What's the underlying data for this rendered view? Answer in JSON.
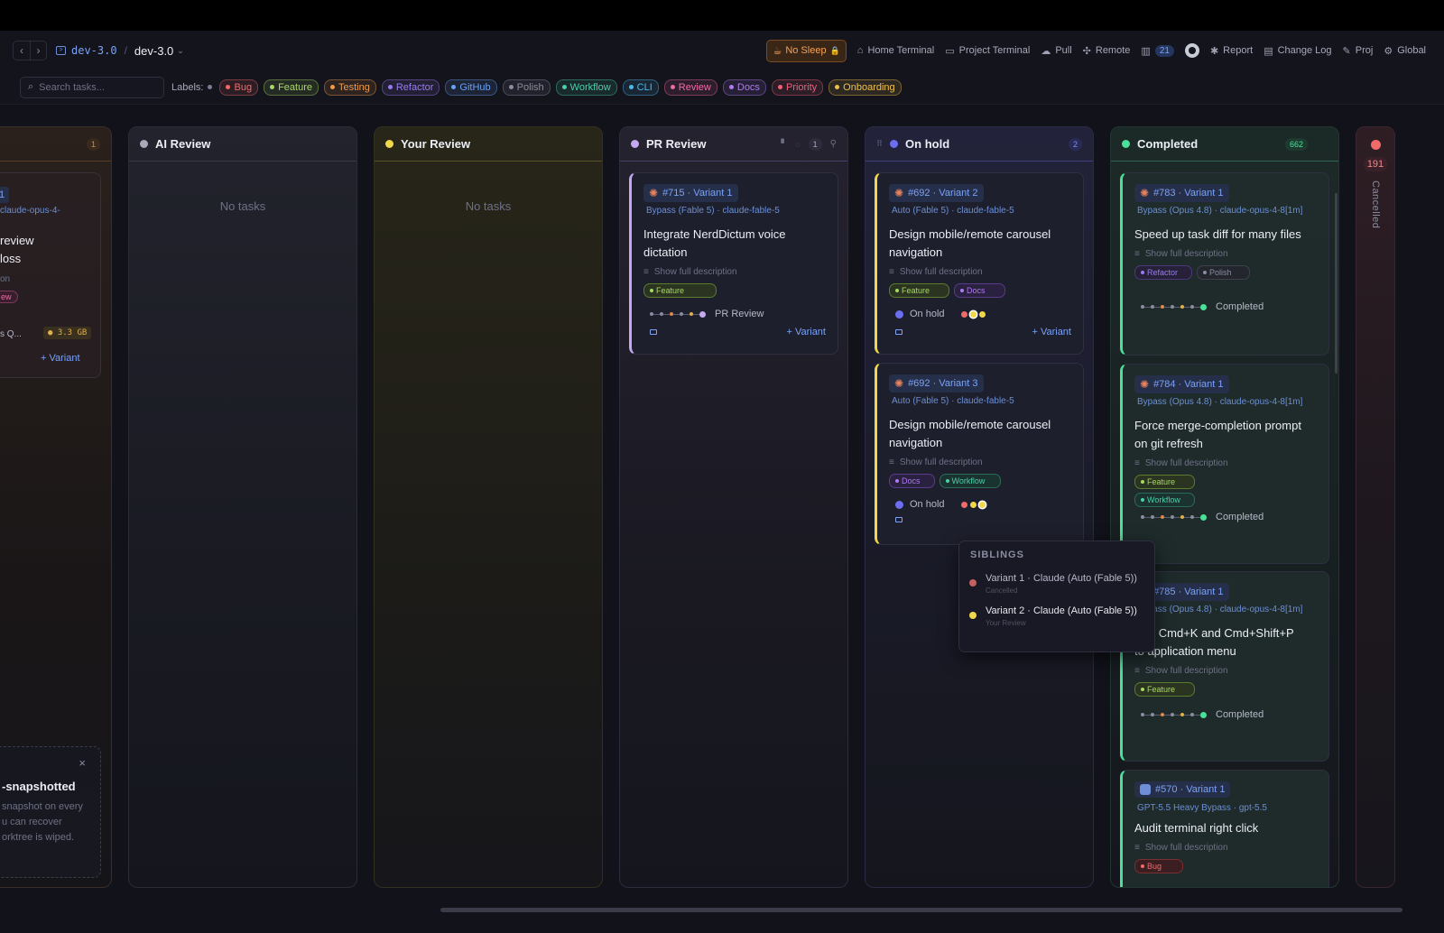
{
  "header": {
    "repo": "dev-3.0",
    "branch": "dev-3.0",
    "no_sleep": "No Sleep",
    "home_terminal": "Home Terminal",
    "project_terminal": "Project Terminal",
    "pull": "Pull",
    "remote": "Remote",
    "count": "21",
    "report": "Report",
    "changelog": "Change Log",
    "proj": "Proj",
    "global": "Global"
  },
  "filters": {
    "search_placeholder": "Search tasks...",
    "labels_title": "Labels:",
    "chips": [
      {
        "label": "Bug",
        "color": "#f06a6a"
      },
      {
        "label": "Feature",
        "color": "#a8d860"
      },
      {
        "label": "Testing",
        "color": "#f09a4a"
      },
      {
        "label": "Refactor",
        "color": "#9a7af0"
      },
      {
        "label": "GitHub",
        "color": "#6aa0f0"
      },
      {
        "label": "Polish",
        "color": "#8a8da0"
      },
      {
        "label": "Workflow",
        "color": "#4ad0a8"
      },
      {
        "label": "CLI",
        "color": "#4ab8f0"
      },
      {
        "label": "Review",
        "color": "#f06aa8"
      },
      {
        "label": "Docs",
        "color": "#b07af0"
      },
      {
        "label": "Priority",
        "color": "#f0607a"
      },
      {
        "label": "Onboarding",
        "color": "#f0c04a"
      }
    ]
  },
  "columns": {
    "left": {
      "count": "1",
      "tag": "1",
      "model": "claude-opus-4-",
      "title_a": "review",
      "title_b": "loss",
      "desc": "on",
      "label": "ew",
      "mem_text": "s Q...",
      "mem": "3.3 GB",
      "add": "+ Variant",
      "toast_title": "-snapshotted",
      "toast_l1": "snapshot on every",
      "toast_l2": "u can recover",
      "toast_l3": "orktree is wiped.",
      "toast_close": "×"
    },
    "ai_review": {
      "title": "AI Review",
      "empty": "No tasks"
    },
    "your_review": {
      "title": "Your Review",
      "empty": "No tasks"
    },
    "pr_review": {
      "title": "PR Review",
      "count": "1"
    },
    "on_hold": {
      "title": "On hold",
      "count": "2"
    },
    "completed": {
      "title": "Completed",
      "count": "662"
    },
    "cancelled": {
      "title": "Cancelled",
      "count": "191"
    }
  },
  "cards": {
    "pr1": {
      "tag": "#715 · Variant 1",
      "model": "Bypass (Fable 5) · claude-fable-5",
      "title": "Integrate NerdDictum voice dictation",
      "desc": "Show full description",
      "labels": [
        "Feature"
      ],
      "status": "PR Review",
      "add": "+ Variant"
    },
    "oh1": {
      "tag": "#692 · Variant 2",
      "model": "Auto (Fable 5) · claude-fable-5",
      "title": "Design mobile/remote carousel navigation",
      "desc": "Show full description",
      "labels": [
        "Feature",
        "Docs"
      ],
      "status": "On hold",
      "add": "+ Variant"
    },
    "oh2": {
      "tag": "#692 · Variant 3",
      "model": "Auto (Fable 5) · claude-fable-5",
      "title": "Design mobile/remote carousel navigation",
      "desc": "Show full description",
      "labels": [
        "Docs",
        "Workflow"
      ],
      "status": "On hold"
    },
    "c1": {
      "tag": "#783 · Variant 1",
      "model": "Bypass (Opus 4.8) · claude-opus-4-8[1m]",
      "title": "Speed up task diff for many files",
      "desc": "Show full description",
      "labels": [
        "Refactor",
        "Polish"
      ],
      "status": "Completed"
    },
    "c2": {
      "tag": "#784 · Variant 1",
      "model": "Bypass (Opus 4.8) · claude-opus-4-8[1m]",
      "title": "Force merge-completion prompt on git refresh",
      "desc": "Show full description",
      "labels": [
        "Feature",
        "Workflow"
      ],
      "status": "Completed"
    },
    "c3": {
      "tag": "#785 · Variant 1",
      "model": "Bypass (Opus 4.8) · claude-opus-4-8[1m]",
      "title": "Add Cmd+K and Cmd+Shift+P to application menu",
      "desc": "Show full description",
      "labels": [
        "Feature"
      ],
      "status": "Completed"
    },
    "c4": {
      "tag": "#570 · Variant 1",
      "model": "GPT-5.5 Heavy Bypass · gpt-5.5",
      "title": "Audit terminal right click",
      "desc": "Show full description",
      "labels": [
        "Bug"
      ]
    }
  },
  "popover": {
    "title": "SIBLINGS",
    "items": [
      {
        "name": "Variant 1 · Claude (Auto (Fable 5))",
        "status": "Cancelled",
        "color": "#c46060"
      },
      {
        "name": "Variant 2 · Claude (Auto (Fable 5))",
        "status": "Your Review",
        "color": "#f0d84a"
      }
    ]
  }
}
